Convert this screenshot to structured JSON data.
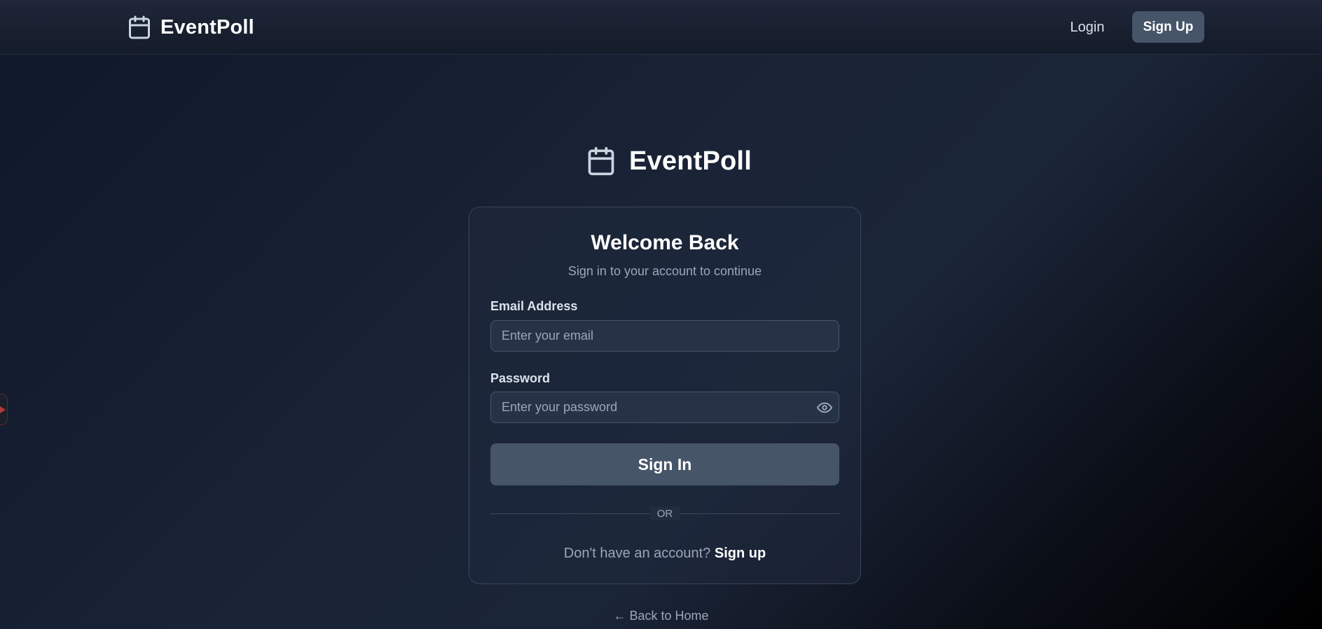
{
  "app": {
    "name": "EventPoll"
  },
  "nav": {
    "login_label": "Login",
    "signup_label": "Sign Up"
  },
  "card": {
    "title": "Welcome Back",
    "subtitle": "Sign in to your account to continue",
    "email": {
      "label": "Email Address",
      "placeholder": "Enter your email",
      "value": ""
    },
    "password": {
      "label": "Password",
      "placeholder": "Enter your password",
      "value": ""
    },
    "signin_label": "Sign In",
    "divider_label": "OR",
    "switch_prompt": "Don't have an account?",
    "switch_link": "Sign up"
  },
  "back_home_label": "← Back to Home",
  "icons": {
    "brand": "calendar-icon",
    "password_toggle": "eye-icon",
    "edge_tab": "play-icon"
  },
  "colors": {
    "accent_button": "#475569",
    "background": "#0f172a",
    "card_bg": "#1e293b",
    "muted_text": "#9aa7b8"
  }
}
